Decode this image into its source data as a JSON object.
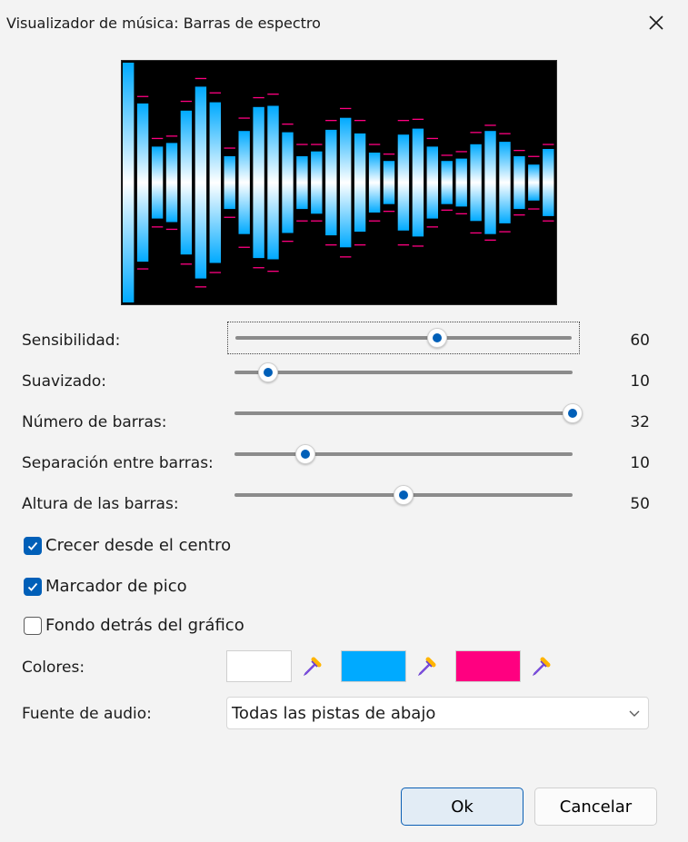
{
  "window": {
    "title": "Visualizador de música: Barras de espectro"
  },
  "sliders": [
    {
      "label": "Sensibilidad:",
      "value": "60",
      "position": 0.6
    },
    {
      "label": "Suavizado:",
      "value": "10",
      "position": 0.1
    },
    {
      "label": "Número de barras:",
      "value": "32",
      "position": 1.0
    },
    {
      "label": "Separación entre barras:",
      "value": "10",
      "position": 0.21
    },
    {
      "label": "Altura de las barras:",
      "value": "50",
      "position": 0.5
    }
  ],
  "checkboxes": [
    {
      "label": "Crecer desde el centro",
      "checked": true
    },
    {
      "label": "Marcador de pico",
      "checked": true
    },
    {
      "label": "Fondo detrás del gráfico",
      "checked": false
    }
  ],
  "colors": {
    "label": "Colores:",
    "swatches": [
      "#ffffff",
      "#00aaff",
      "#ff0080"
    ],
    "picker_icon": "eyedropper-icon"
  },
  "audio_source": {
    "label": "Fuente de audio:",
    "selected": "Todas las pistas de abajo"
  },
  "buttons": {
    "ok": "Ok",
    "cancel": "Cancelar"
  },
  "spectrum": {
    "bar_levels": [
      1.0,
      0.66,
      0.3,
      0.33,
      0.6,
      0.8,
      0.67,
      0.22,
      0.43,
      0.63,
      0.64,
      0.42,
      0.22,
      0.26,
      0.44,
      0.54,
      0.41,
      0.25,
      0.18,
      0.4,
      0.45,
      0.3,
      0.18,
      0.2,
      0.32,
      0.43,
      0.34,
      0.22,
      0.15,
      0.28
    ],
    "peak_levels": [
      1.0,
      0.7,
      0.35,
      0.37,
      0.66,
      0.85,
      0.73,
      0.27,
      0.52,
      0.69,
      0.72,
      0.47,
      0.3,
      0.3,
      0.5,
      0.6,
      0.5,
      0.3,
      0.22,
      0.5,
      0.51,
      0.35,
      0.21,
      0.24,
      0.4,
      0.46,
      0.39,
      0.25,
      0.2,
      0.3
    ],
    "bar_gradient": [
      "#ffffff",
      "#00aaff"
    ],
    "peak_color": "#ff0080"
  }
}
